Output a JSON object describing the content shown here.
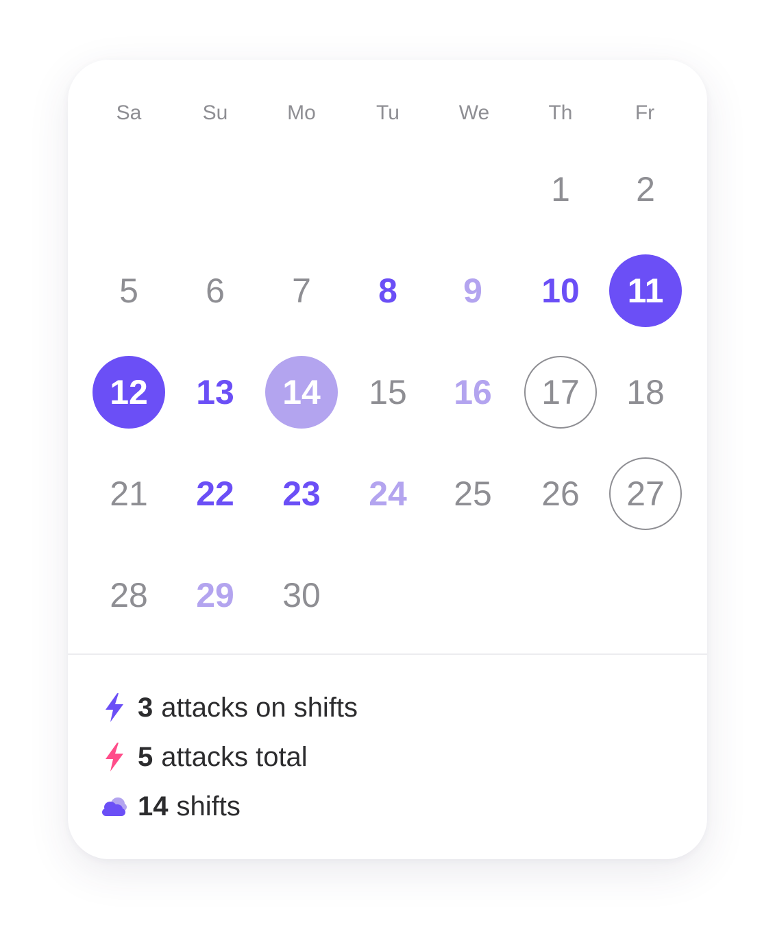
{
  "weekdays": [
    "Sa",
    "Su",
    "Mo",
    "Tu",
    "We",
    "Th",
    "Fr"
  ],
  "weeks": [
    [
      {
        "label": "",
        "style": "empty"
      },
      {
        "label": "",
        "style": "empty"
      },
      {
        "label": "",
        "style": "empty"
      },
      {
        "label": "",
        "style": "empty"
      },
      {
        "label": "",
        "style": "empty"
      },
      {
        "label": "1",
        "style": "normal"
      },
      {
        "label": "2",
        "style": "normal"
      }
    ],
    [
      {
        "label": "5",
        "style": "normal"
      },
      {
        "label": "6",
        "style": "normal"
      },
      {
        "label": "7",
        "style": "normal"
      },
      {
        "label": "8",
        "style": "shift"
      },
      {
        "label": "9",
        "style": "shift-light"
      },
      {
        "label": "10",
        "style": "shift"
      },
      {
        "label": "11",
        "style": "sel"
      }
    ],
    [
      {
        "label": "12",
        "style": "sel"
      },
      {
        "label": "13",
        "style": "shift"
      },
      {
        "label": "14",
        "style": "sel-light"
      },
      {
        "label": "15",
        "style": "normal"
      },
      {
        "label": "16",
        "style": "shift-light"
      },
      {
        "label": "17",
        "style": "ring"
      },
      {
        "label": "18",
        "style": "normal"
      }
    ],
    [
      {
        "label": "21",
        "style": "normal"
      },
      {
        "label": "22",
        "style": "shift"
      },
      {
        "label": "23",
        "style": "shift"
      },
      {
        "label": "24",
        "style": "shift-light"
      },
      {
        "label": "25",
        "style": "normal"
      },
      {
        "label": "26",
        "style": "normal"
      },
      {
        "label": "27",
        "style": "ring"
      }
    ],
    [
      {
        "label": "28",
        "style": "normal"
      },
      {
        "label": "29",
        "style": "shift-light"
      },
      {
        "label": "30",
        "style": "normal"
      },
      {
        "label": "",
        "style": "empty"
      },
      {
        "label": "",
        "style": "empty"
      },
      {
        "label": "",
        "style": "empty"
      },
      {
        "label": "",
        "style": "empty"
      }
    ]
  ],
  "stats": {
    "shift_attacks": {
      "count": "3",
      "text": "attacks on shifts",
      "icon": "lightning-icon",
      "color": "#6b4ff6"
    },
    "total_attacks": {
      "count": "5",
      "text": "attacks total",
      "icon": "lightning-icon",
      "color": "#ff4d8a"
    },
    "shifts": {
      "count": "14",
      "text": "shifts",
      "icon": "cloud-icon",
      "color": "#6b4ff6"
    }
  },
  "colors": {
    "accent": "#6b4ff6",
    "accent_light": "#b3a4ef",
    "muted_text": "#8e8e93",
    "pink": "#ff4d8a"
  }
}
